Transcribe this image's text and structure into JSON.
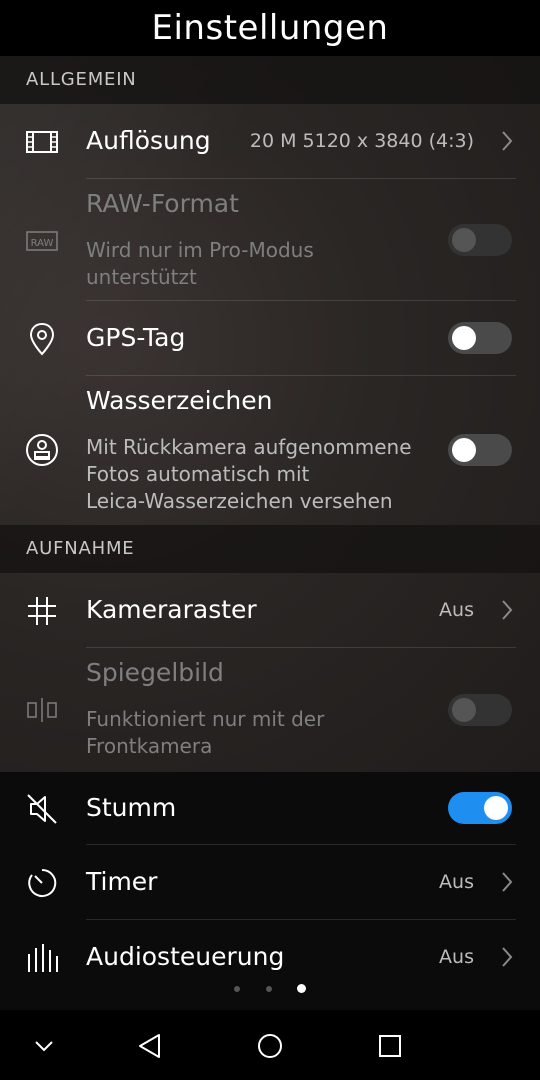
{
  "header": {
    "title": "Einstellungen"
  },
  "sections": {
    "general": "ALLGEMEIN",
    "capture": "AUFNAHME"
  },
  "rows": {
    "resolution": {
      "label": "Auflösung",
      "value": "20 M 5120 x 3840 (4:3)",
      "icon": "resolution-frame-icon"
    },
    "raw": {
      "label": "RAW-Format",
      "sub1": "Wird nur im Pro-Modus",
      "sub2": "unterstützt",
      "icon": "raw-icon",
      "icon_text": "RAW",
      "toggle": false,
      "enabled": false
    },
    "gps": {
      "label": "GPS-Tag",
      "icon": "location-pin-icon",
      "toggle": false
    },
    "watermark": {
      "label": "Wasserzeichen",
      "sub1": "Mit Rückkamera aufgenommene",
      "sub2": "Fotos automatisch mit",
      "sub3": "Leica-Wasserzeichen versehen",
      "icon": "stamp-icon",
      "toggle": false
    },
    "grid": {
      "label": "Kameraraster",
      "value": "Aus",
      "icon": "grid-icon"
    },
    "mirror": {
      "label": "Spiegelbild",
      "sub1": "Funktioniert nur mit der",
      "sub2": "Frontkamera",
      "icon": "mirror-icon",
      "toggle": false,
      "enabled": false
    },
    "mute": {
      "label": "Stumm",
      "icon": "mute-speaker-icon",
      "toggle": true
    },
    "timer": {
      "label": "Timer",
      "value": "Aus",
      "icon": "timer-icon"
    },
    "audio": {
      "label": "Audiosteuerung",
      "value": "Aus",
      "icon": "audio-bars-icon"
    }
  },
  "page_indicator": {
    "count": 3,
    "active": 3
  },
  "navbar": [
    "collapse-chevron-icon",
    "back-triangle-icon",
    "home-circle-icon",
    "recents-square-icon"
  ],
  "colors": {
    "accent": "#1e8ff0",
    "background": "#0b0b0b"
  }
}
